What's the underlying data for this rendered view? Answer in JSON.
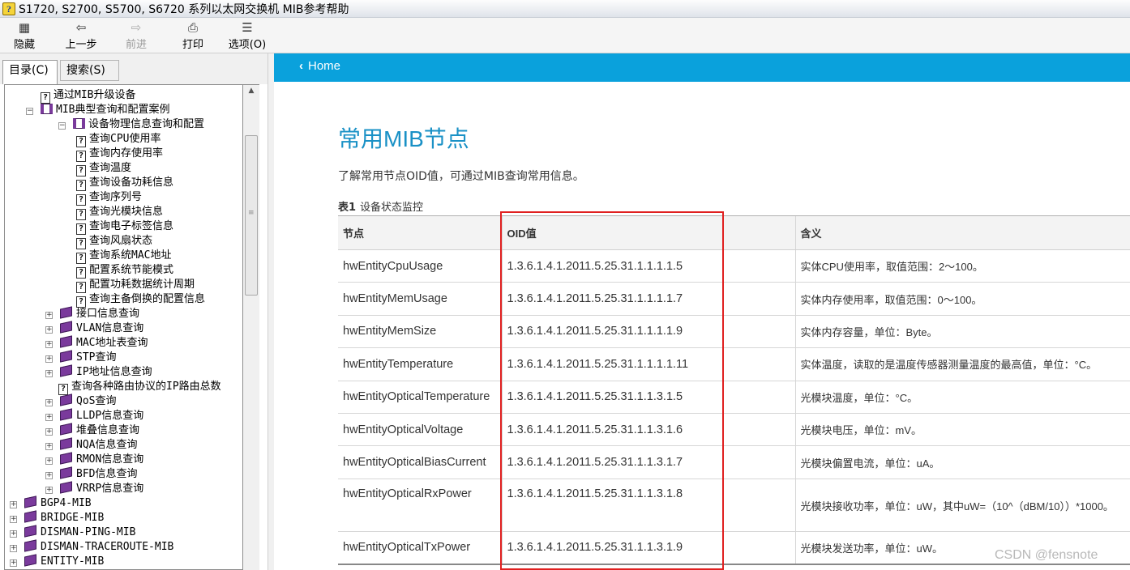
{
  "window": {
    "title": "S1720, S2700, S5700, S6720 系列以太网交换机 MIB参考帮助"
  },
  "toolbar": {
    "hide": "隐藏",
    "back": "上一步",
    "forward": "前进",
    "print": "打印",
    "options": "选项(O)"
  },
  "tabs": {
    "contents": "目录(C)",
    "search": "搜索(S)"
  },
  "tree": [
    {
      "label": "通过MIB升级设备",
      "icon": "question-page"
    },
    {
      "label": "MIB典型查询和配置案例",
      "icon": "open-book",
      "toggle": "-"
    },
    {
      "label": "设备物理信息查询和配置",
      "icon": "open-book",
      "toggle": "-"
    },
    {
      "label": "查询CPU使用率",
      "icon": "question-page"
    },
    {
      "label": "查询内存使用率",
      "icon": "question-page"
    },
    {
      "label": "查询温度",
      "icon": "question-page"
    },
    {
      "label": "查询设备功耗信息",
      "icon": "question-page"
    },
    {
      "label": "查询序列号",
      "icon": "question-page"
    },
    {
      "label": "查询光模块信息",
      "icon": "question-page"
    },
    {
      "label": "查询电子标签信息",
      "icon": "question-page"
    },
    {
      "label": "查询风扇状态",
      "icon": "question-page"
    },
    {
      "label": "查询系统MAC地址",
      "icon": "question-page"
    },
    {
      "label": "配置系统节能模式",
      "icon": "question-page"
    },
    {
      "label": "配置功耗数据统计周期",
      "icon": "question-page"
    },
    {
      "label": "查询主备倒换的配置信息",
      "icon": "question-page"
    },
    {
      "label": "接口信息查询",
      "icon": "closed-book",
      "toggle": "+"
    },
    {
      "label": "VLAN信息查询",
      "icon": "closed-book",
      "toggle": "+"
    },
    {
      "label": "MAC地址表查询",
      "icon": "closed-book",
      "toggle": "+"
    },
    {
      "label": "STP查询",
      "icon": "closed-book",
      "toggle": "+"
    },
    {
      "label": "IP地址信息查询",
      "icon": "closed-book",
      "toggle": "+"
    },
    {
      "label": "查询各种路由协议的IP路由总数",
      "icon": "question-page"
    },
    {
      "label": "QoS查询",
      "icon": "closed-book",
      "toggle": "+"
    },
    {
      "label": "LLDP信息查询",
      "icon": "closed-book",
      "toggle": "+"
    },
    {
      "label": "堆叠信息查询",
      "icon": "closed-book",
      "toggle": "+"
    },
    {
      "label": "NQA信息查询",
      "icon": "closed-book",
      "toggle": "+"
    },
    {
      "label": "RMON信息查询",
      "icon": "closed-book",
      "toggle": "+"
    },
    {
      "label": "BFD信息查询",
      "icon": "closed-book",
      "toggle": "+"
    },
    {
      "label": "VRRP信息查询",
      "icon": "closed-book",
      "toggle": "+"
    },
    {
      "label": "BGP4-MIB",
      "icon": "closed-book",
      "toggle": "+"
    },
    {
      "label": "BRIDGE-MIB",
      "icon": "closed-book",
      "toggle": "+"
    },
    {
      "label": "DISMAN-PING-MIB",
      "icon": "closed-book",
      "toggle": "+"
    },
    {
      "label": "DISMAN-TRACEROUTE-MIB",
      "icon": "closed-book",
      "toggle": "+"
    },
    {
      "label": "ENTITY-MIB",
      "icon": "closed-book",
      "toggle": "+"
    }
  ],
  "content": {
    "home_link": "Home",
    "title": "常用MIB节点",
    "intro": "了解常用节点OID值，可通过MIB查询常用信息。",
    "table_caption_num": "表1",
    "table_caption_text": "设备状态监控",
    "columns": [
      "节点",
      "OID值",
      "含义"
    ],
    "rows": [
      [
        "hwEntityCpuUsage",
        "1.3.6.1.4.1.2011.5.25.31.1.1.1.1.5",
        "实体CPU使用率，取值范围：2～100。"
      ],
      [
        "hwEntityMemUsage",
        "1.3.6.1.4.1.2011.5.25.31.1.1.1.1.7",
        "实体内存使用率，取值范围：0～100。"
      ],
      [
        "hwEntityMemSize",
        "1.3.6.1.4.1.2011.5.25.31.1.1.1.1.9",
        "实体内存容量，单位：Byte。"
      ],
      [
        "hwEntityTemperature",
        "1.3.6.1.4.1.2011.5.25.31.1.1.1.1.11",
        "实体温度，读取的是温度传感器测量温度的最高值，单位：°C。"
      ],
      [
        "hwEntityOpticalTemperature",
        "1.3.6.1.4.1.2011.5.25.31.1.1.3.1.5",
        "光模块温度，单位：°C。"
      ],
      [
        "hwEntityOpticalVoltage",
        "1.3.6.1.4.1.2011.5.25.31.1.1.3.1.6",
        "光模块电压，单位：mV。"
      ],
      [
        "hwEntityOpticalBiasCurrent",
        "1.3.6.1.4.1.2011.5.25.31.1.1.3.1.7",
        "光模块偏置电流，单位：uA。"
      ],
      [
        "hwEntityOpticalRxPower",
        "1.3.6.1.4.1.2011.5.25.31.1.1.3.1.8",
        "光模块接收功率，单位：uW，其中uW=（10^（dBM/10））*1000。"
      ],
      [
        "hwEntityOpticalTxPower",
        "1.3.6.1.4.1.2011.5.25.31.1.1.3.1.9",
        "光模块发送功率，单位：uW。"
      ]
    ]
  },
  "watermark": "CSDN @fensnote",
  "colors": {
    "topbar": "#0aa1dc",
    "title": "#1a91c6",
    "highlight_box": "#e02020"
  }
}
